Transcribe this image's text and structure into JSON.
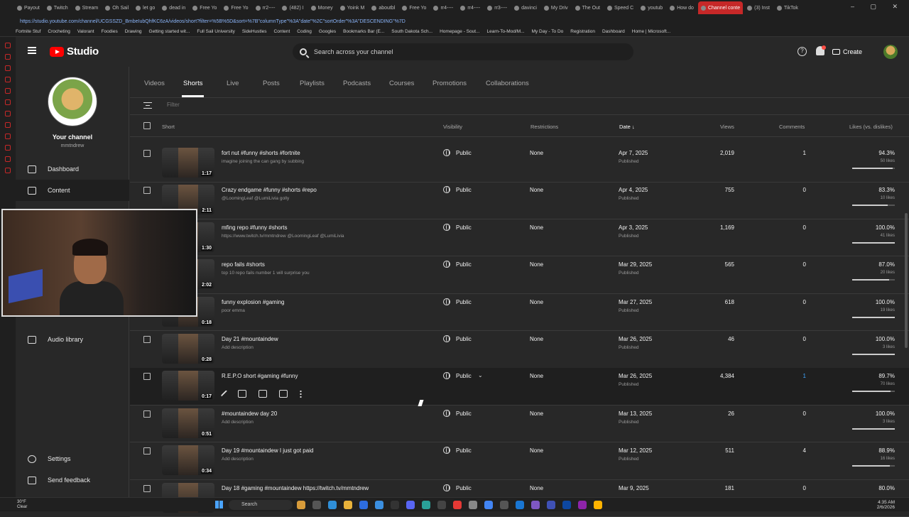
{
  "browser": {
    "tabs": [
      "Payout",
      "Twitch",
      "Stream",
      "Oh Sail",
      "let go",
      "dead in",
      "Free Yo",
      "Free Yo",
      "rr2----",
      "(482) I",
      "Money",
      "Yoink M",
      "aboutbl",
      "Free Yo",
      "rr4----",
      "rr4----",
      "rr3----",
      "davinci",
      "My Driv",
      "The Out",
      "Speed C",
      "youtub",
      "How do",
      "Channel conte",
      "(3) Inst",
      "TikTok"
    ],
    "active_tab_index": 23,
    "url": "https://studio.youtube.com/channel/UCGSSZD_BmbeIubQhfKC6zA/videos/short?filter=%5B%5D&sort=%7B\"columnType\"%3A\"date\"%2C\"sortOrder\"%3A\"DESCENDING\"%7D",
    "bookmarks": [
      "Fortnite Stuf",
      "Crocheting",
      "Valorant",
      "Foodies",
      "Drawing",
      "Getting started wit...",
      "Full Sail University",
      "SideHustles",
      "Content",
      "Coding",
      "Googles",
      "Bookmarks Bar (E...",
      "South Dakota Sch...",
      "Homepage - Sout...",
      "Learn-To-Mod/M...",
      "My Day - To Do",
      "Registration",
      "Dashboard",
      "Home | Microsoft..."
    ]
  },
  "header": {
    "logo_text": "Studio",
    "search_placeholder": "Search across your channel",
    "help_glyph": "?",
    "create_label": "Create"
  },
  "sidebar": {
    "channel_title": "Your channel",
    "channel_handle": "mmtndrew",
    "items": [
      {
        "label": "Dashboard",
        "icon": "dashboard-icon"
      },
      {
        "label": "Content",
        "icon": "content-icon"
      },
      {
        "label": "Audio library",
        "icon": "audio-library-icon"
      },
      {
        "label": "Settings",
        "icon": "gear-icon"
      },
      {
        "label": "Send feedback",
        "icon": "feedback-icon"
      }
    ]
  },
  "content_tabs": [
    "Videos",
    "Shorts",
    "Live",
    "Posts",
    "Playlists",
    "Podcasts",
    "Courses",
    "Promotions",
    "Collaborations"
  ],
  "active_content_tab": "Shorts",
  "filter_placeholder": "Filter",
  "columns": {
    "short": "Short",
    "visibility": "Visibility",
    "restrictions": "Restrictions",
    "date": "Date",
    "date_sort_glyph": "↓",
    "views": "Views",
    "comments": "Comments",
    "likes": "Likes (vs. dislikes)"
  },
  "rows": [
    {
      "duration": "1:17",
      "title": "fort nut #funny #shorts #fortnite",
      "desc": "imagine joining the can gang by subbing",
      "visibility": "Public",
      "restrictions": "None",
      "date": "Apr 7, 2025",
      "status": "Published",
      "views": "2,019",
      "comments": "1",
      "likes_pct": "94.3%",
      "likes": "50 likes",
      "ratio": 0.943
    },
    {
      "duration": "2:11",
      "title": "Crazy endgame #funny #shorts #repo",
      "desc": "@LoomingLeaf @LumiLivia golly",
      "visibility": "Public",
      "restrictions": "None",
      "date": "Apr 4, 2025",
      "status": "Published",
      "views": "755",
      "comments": "0",
      "likes_pct": "83.3%",
      "likes": "10 likes",
      "ratio": 0.833
    },
    {
      "duration": "1:30",
      "title": "mfing repo #funny #shorts",
      "desc": "https://www.twitch.tv/mmtndrew @LoomingLeaf @LumiLivia",
      "visibility": "Public",
      "restrictions": "None",
      "date": "Apr 3, 2025",
      "status": "Published",
      "views": "1,169",
      "comments": "0",
      "likes_pct": "100.0%",
      "likes": "41 likes",
      "ratio": 1.0
    },
    {
      "duration": "2:02",
      "title": "repo fails #shorts",
      "desc": "top 10 repo fails number 1 will surprise you",
      "visibility": "Public",
      "restrictions": "None",
      "date": "Mar 29, 2025",
      "status": "Published",
      "views": "565",
      "comments": "0",
      "likes_pct": "87.0%",
      "likes": "20 likes",
      "ratio": 0.87
    },
    {
      "duration": "0:18",
      "title": "funny explosion #gaming",
      "desc": "poor emma",
      "visibility": "Public",
      "restrictions": "None",
      "date": "Mar 27, 2025",
      "status": "Published",
      "views": "618",
      "comments": "0",
      "likes_pct": "100.0%",
      "likes": "19 likes",
      "ratio": 1.0
    },
    {
      "duration": "0:28",
      "title": "Day 21 #mountaindew",
      "desc": "Add description",
      "visibility": "Public",
      "restrictions": "None",
      "date": "Mar 26, 2025",
      "status": "Published",
      "views": "46",
      "comments": "0",
      "likes_pct": "100.0%",
      "likes": "3 likes",
      "ratio": 1.0
    },
    {
      "duration": "0:17",
      "title": "R.E.P.O short #gaming #funny",
      "desc": "",
      "visibility": "Public",
      "restrictions": "None",
      "date": "Mar 26, 2025",
      "status": "Published",
      "views": "4,384",
      "comments": "1",
      "likes_pct": "89.7%",
      "likes": "70 likes",
      "ratio": 0.897,
      "hovered": true
    },
    {
      "duration": "0:51",
      "title": "#mountaindew day 20",
      "desc": "Add description",
      "visibility": "Public",
      "restrictions": "None",
      "date": "Mar 13, 2025",
      "status": "Published",
      "views": "26",
      "comments": "0",
      "likes_pct": "100.0%",
      "likes": "3 likes",
      "ratio": 1.0
    },
    {
      "duration": "0:34",
      "title": "Day 19 #mountaindew I just got paid",
      "desc": "Add description",
      "visibility": "Public",
      "restrictions": "None",
      "date": "Mar 12, 2025",
      "status": "Published",
      "views": "511",
      "comments": "4",
      "likes_pct": "88.9%",
      "likes": "16 likes",
      "ratio": 0.889
    },
    {
      "duration": "",
      "title": "Day 18 #gaming #mountaindew https://twitch.tv/mmtndrew",
      "desc": "",
      "visibility": "Public",
      "restrictions": "None",
      "date": "Mar 9, 2025",
      "status": "",
      "views": "181",
      "comments": "0",
      "likes_pct": "80.0%",
      "likes": "",
      "ratio": 0.8
    }
  ],
  "taskbar": {
    "weather_temp": "30°F",
    "weather_desc": "Clear",
    "search_label": "Search",
    "time": "4:35 AM",
    "date": "2/6/2026"
  },
  "colors": {
    "accent_red": "#ff0000",
    "link_blue": "#3ea6ff",
    "bg": "#282828"
  }
}
